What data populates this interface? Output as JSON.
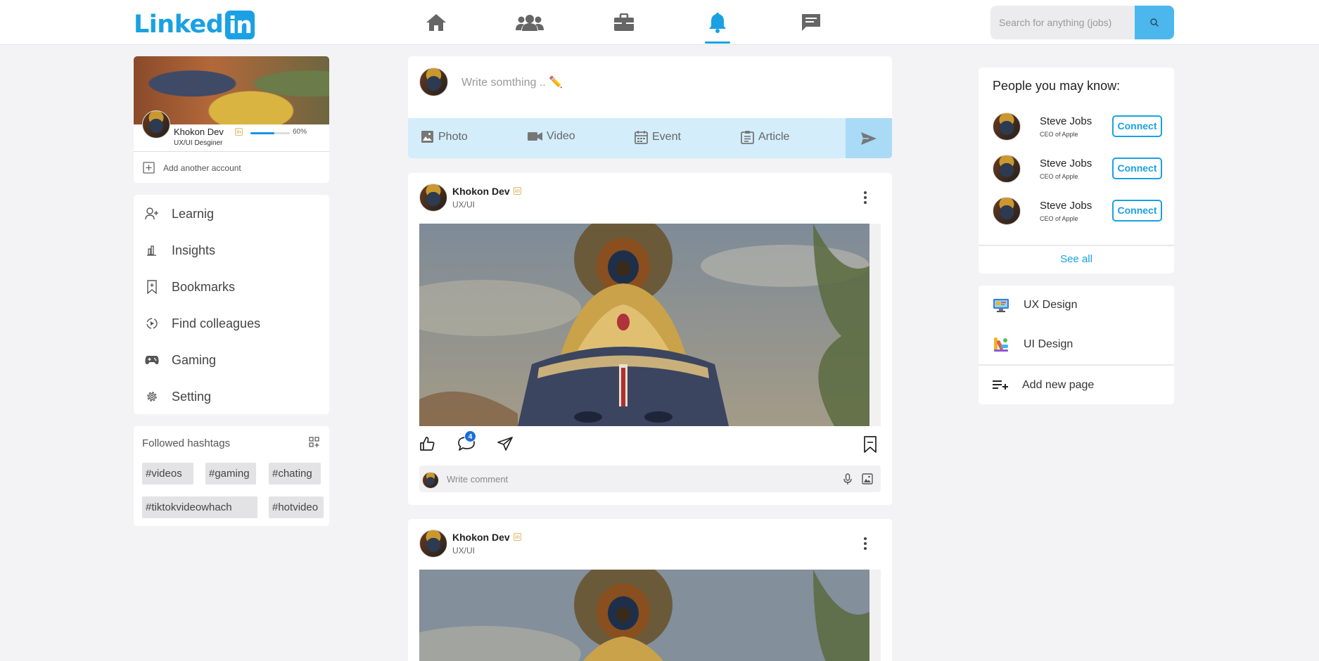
{
  "brand": {
    "logo_text": "Linked",
    "logo_box": "in",
    "color": "#1aa1e4"
  },
  "nav": {
    "icons": [
      "home-icon",
      "people-icon",
      "briefcase-icon",
      "bell-icon",
      "message-icon"
    ],
    "active": "bell-icon"
  },
  "search": {
    "placeholder": "Search for anything (jobs)"
  },
  "profile": {
    "name": "Khokon Dev",
    "title": "UX/UI Desginer",
    "progress_text": "60%",
    "progress_value": 0.6,
    "add_account": "Add another account"
  },
  "menu": {
    "items": [
      {
        "label": "Learnig",
        "icon": "add-user-icon"
      },
      {
        "label": "Insights",
        "icon": "insights-icon"
      },
      {
        "label": "Bookmarks",
        "icon": "bookmark-icon"
      },
      {
        "label": "Find colleagues",
        "icon": "find-icon"
      },
      {
        "label": "Gaming",
        "icon": "gamepad-icon"
      },
      {
        "label": "Setting",
        "icon": "gear-icon"
      }
    ]
  },
  "hashtags": {
    "title": "Followed hashtags",
    "tags": [
      "#videos",
      "#gaming",
      "#chating",
      "#tiktokvideowhach",
      "#hotvideo"
    ]
  },
  "composer": {
    "placeholder": "Write somthing .. ✏️",
    "actions": [
      {
        "label": "Photo",
        "icon": "photo-icon"
      },
      {
        "label": "Video",
        "icon": "video-icon"
      },
      {
        "label": "Event",
        "icon": "calendar-icon"
      },
      {
        "label": "Article",
        "icon": "article-icon"
      }
    ]
  },
  "posts": [
    {
      "author": "Khokon Dev",
      "subtitle": "UX/UI",
      "comment_count": "4",
      "comment_placeholder": "Write comment"
    },
    {
      "author": "Khokon Dev",
      "subtitle": "UX/UI"
    }
  ],
  "people": {
    "title": "People you may know:",
    "items": [
      {
        "name": "Steve Jobs",
        "subtitle": "CEO of Apple",
        "action": "Connect"
      },
      {
        "name": "Steve Jobs",
        "subtitle": "CEO of Apple",
        "action": "Connect"
      },
      {
        "name": "Steve Jobs",
        "subtitle": "CEO of Apple",
        "action": "Connect"
      }
    ],
    "see_all": "See all"
  },
  "pages": {
    "items": [
      {
        "label": "UX Design",
        "icon": "ux-design-icon"
      },
      {
        "label": "UI Design",
        "icon": "ui-design-icon"
      }
    ],
    "add_new": "Add new page"
  }
}
